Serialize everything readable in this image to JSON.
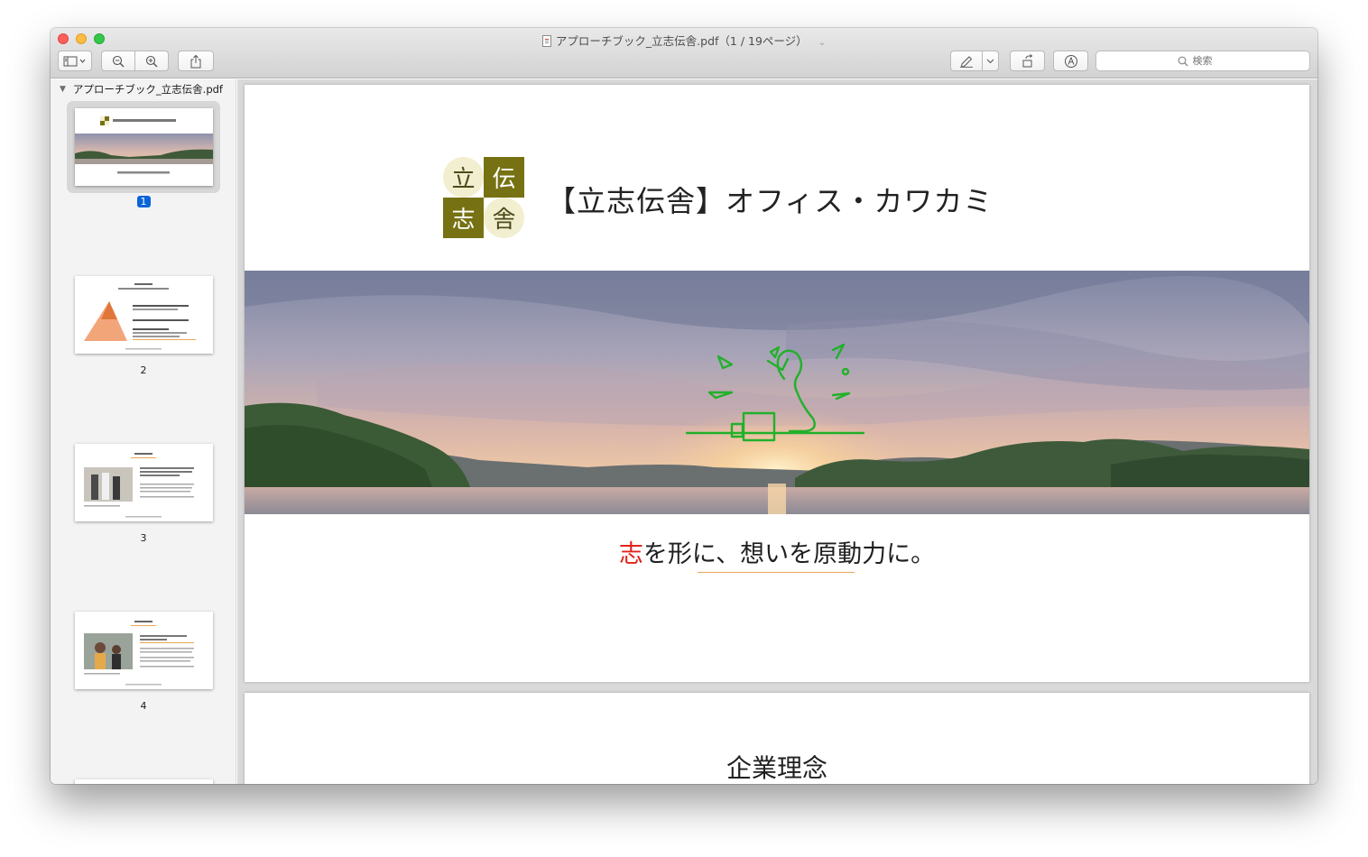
{
  "window": {
    "title": "アプローチブック_立志伝舎.pdf（1 / 19ページ）"
  },
  "toolbar": {
    "sidebar_icon": "sidebar-icon",
    "zoom_out_icon": "zoom-out-icon",
    "zoom_in_icon": "zoom-in-icon",
    "share_icon": "share-icon",
    "markup_icon": "pen-icon",
    "rotate_icon": "rotate-icon",
    "annotate_icon": "annotate-icon",
    "search_placeholder": "検索"
  },
  "sidebar": {
    "document_name": "アプローチブック_立志伝舎.pdf",
    "thumbnails": [
      {
        "label": "1",
        "selected": true
      },
      {
        "label": "2",
        "selected": false
      },
      {
        "label": "3",
        "selected": false
      },
      {
        "label": "4",
        "selected": false
      }
    ]
  },
  "page1": {
    "logo_chars": [
      "立",
      "伝",
      "志",
      "舎"
    ],
    "company_name": "【立志伝舎】オフィス・カワカミ",
    "tagline_accent": "志",
    "tagline_rest": "を形に、想いを原動力に。"
  },
  "page2": {
    "heading": "企業理念"
  },
  "colors": {
    "logo_dark": "#767112",
    "logo_light": "#f1efcf",
    "tagline_accent": "#e0241b",
    "underline": "#e7a654",
    "selection": "#0b64d8"
  }
}
